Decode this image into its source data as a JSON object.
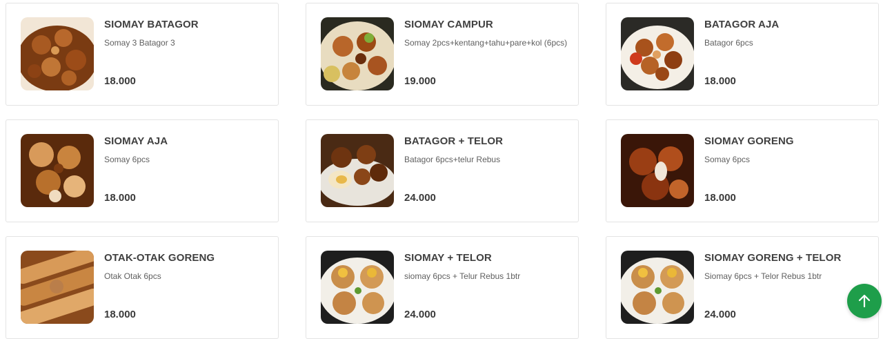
{
  "menu_items": [
    {
      "name": "SIOMAY BATAGOR",
      "description": "Somay 3 Batagor 3",
      "price": "18.000"
    },
    {
      "name": "SIOMAY CAMPUR",
      "description": "Somay 2pcs+kentang+tahu+pare+kol (6pcs)",
      "price": "19.000"
    },
    {
      "name": "BATAGOR AJA",
      "description": "Batagor 6pcs",
      "price": "18.000"
    },
    {
      "name": "SIOMAY AJA",
      "description": "Somay 6pcs",
      "price": "18.000"
    },
    {
      "name": "BATAGOR + TELOR",
      "description": "Batagor 6pcs+telur Rebus",
      "price": "24.000"
    },
    {
      "name": "SIOMAY GORENG",
      "description": "Somay 6pcs",
      "price": "18.000"
    },
    {
      "name": "OTAK-OTAK GORENG",
      "description": "Otak Otak 6pcs",
      "price": "18.000"
    },
    {
      "name": "SIOMAY + TELOR",
      "description": "siomay 6pcs + Telur Rebus 1btr",
      "price": "24.000"
    },
    {
      "name": "SIOMAY GORENG + TELOR",
      "description": "Siomay 6pcs + Telor Rebus 1btr",
      "price": "24.000"
    }
  ],
  "scroll_top_button": {
    "icon": "arrow-up-icon",
    "color": "#1e9e4a"
  }
}
